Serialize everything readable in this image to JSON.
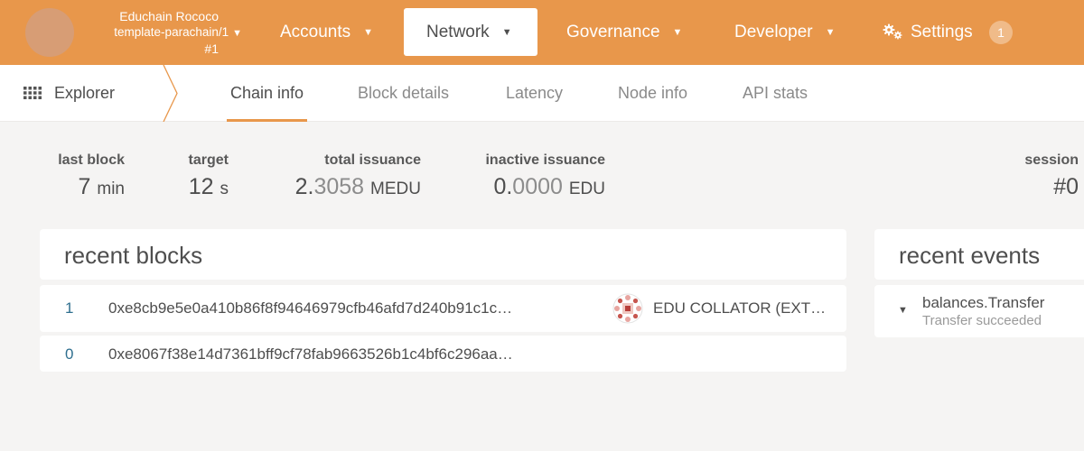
{
  "header": {
    "chain_name": "Educhain Rococo",
    "parachain": "template-parachain/1",
    "block_number": "#1",
    "nav": {
      "accounts": "Accounts",
      "network": "Network",
      "governance": "Governance",
      "developer": "Developer",
      "settings": "Settings"
    },
    "settings_badge": "1"
  },
  "subnav": {
    "section": "Explorer",
    "tabs": [
      "Chain info",
      "Block details",
      "Latency",
      "Node info",
      "API stats"
    ],
    "active_tab": "Chain info"
  },
  "summary": {
    "last_block": {
      "label": "last block",
      "value": "7",
      "unit": "min"
    },
    "target": {
      "label": "target",
      "value": "12",
      "unit": "s"
    },
    "total_issuance": {
      "label": "total issuance",
      "int": "2.",
      "frac": "3058",
      "unit": "MEDU"
    },
    "inactive_issuance": {
      "label": "inactive issuance",
      "int": "0.",
      "frac": "0000",
      "unit": "EDU"
    },
    "session": {
      "label": "session",
      "value": "#0"
    }
  },
  "recent_blocks": {
    "title": "recent blocks",
    "rows": [
      {
        "number": "1",
        "hash": "0xe8cb9e5e0a410b86f8f94646979cfb46afd7d240b91c1c…",
        "author": "EDU COLLATOR (EXT…"
      },
      {
        "number": "0",
        "hash": "0xe8067f38e14d7361bff9cf78fab9663526b1c4bf6c296aa…",
        "author": ""
      }
    ]
  },
  "recent_events": {
    "title": "recent events",
    "items": [
      {
        "title": "balances.Transfer",
        "subtitle": "Transfer succeeded"
      }
    ]
  },
  "colors": {
    "brand": "#e8974b",
    "link": "#2f6f8f"
  }
}
